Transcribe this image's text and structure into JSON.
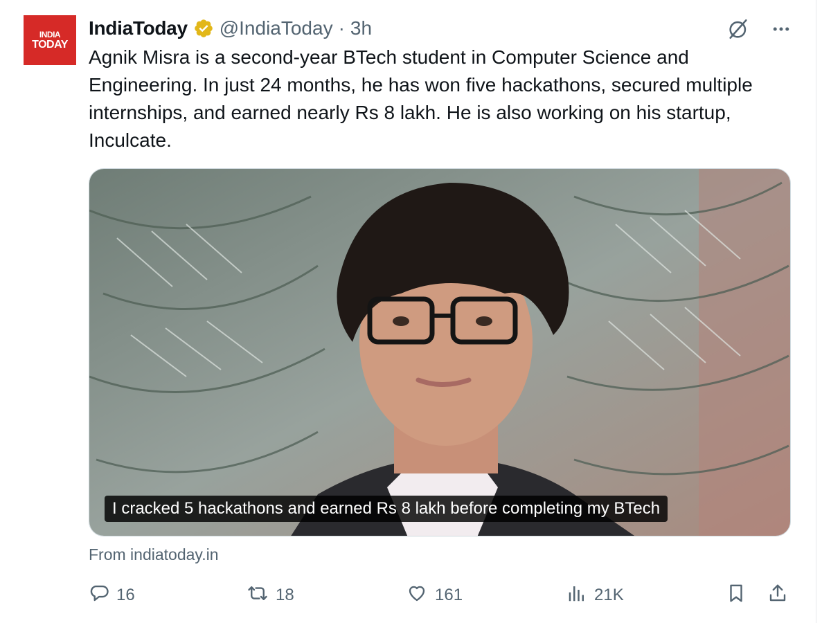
{
  "account": {
    "avatar_text_line1": "INDIA",
    "avatar_text_line2": "TODAY",
    "display_name": "IndiaToday",
    "handle": "@IndiaToday",
    "separator": "·",
    "time": "3h",
    "verified": true
  },
  "tweet": {
    "text": "Agnik Misra is a second-year BTech student in Computer Science and Engineering. In just 24 months, he has won five hackathons, secured multiple internships, and earned nearly Rs 8 lakh. He is also working on his startup, Inculcate."
  },
  "media": {
    "caption": "I cracked 5 hackathons and earned Rs 8 lakh before completing my BTech"
  },
  "source": {
    "label": "From indiatoday.in"
  },
  "actions": {
    "replies": "16",
    "reposts": "18",
    "likes": "161",
    "views": "21K"
  },
  "icons": {
    "top_right": [
      "grok-icon",
      "more-icon"
    ],
    "action_bar": [
      "reply-icon",
      "retweet-icon",
      "like-icon",
      "views-icon",
      "bookmark-icon",
      "share-icon"
    ]
  },
  "colors": {
    "brand_red": "#d62a27",
    "verified_gold": "#e2b719",
    "text_primary": "#0f1419",
    "text_secondary": "#536471",
    "border": "#cfd9de"
  }
}
